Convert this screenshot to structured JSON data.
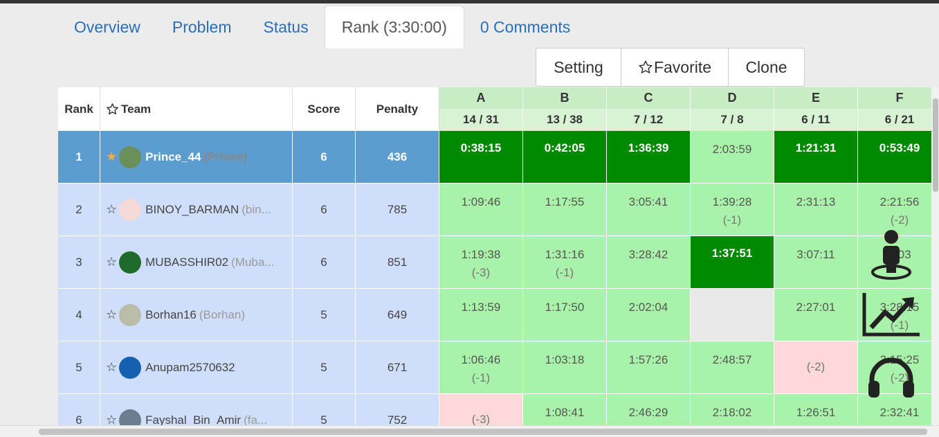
{
  "tabs": [
    {
      "label": "Overview"
    },
    {
      "label": "Problem"
    },
    {
      "label": "Status"
    },
    {
      "label": "Rank (3:30:00)"
    },
    {
      "label": "0 Comments"
    }
  ],
  "actions": {
    "setting": "Setting",
    "favorite": "Favorite",
    "clone": "Clone"
  },
  "table": {
    "headers": {
      "rank": "Rank",
      "team": "Team",
      "score": "Score",
      "penalty": "Penalty"
    },
    "problems": [
      {
        "id": "A",
        "stat": "14 / 31"
      },
      {
        "id": "B",
        "stat": "13 / 38"
      },
      {
        "id": "C",
        "stat": "7 / 12"
      },
      {
        "id": "D",
        "stat": "7 / 8"
      },
      {
        "id": "E",
        "stat": "6 / 11"
      },
      {
        "id": "F",
        "stat": "6 / 21"
      }
    ],
    "rows": [
      {
        "rank": "1",
        "team": "Prince_44",
        "nick": "(Prince)",
        "score": "6",
        "penalty": "436",
        "cells": [
          [
            "0:38:15",
            ""
          ],
          [
            "0:42:05",
            ""
          ],
          [
            "1:36:39",
            ""
          ],
          [
            "2:03:59",
            ""
          ],
          [
            "1:21:31",
            ""
          ],
          [
            "0:53:49",
            ""
          ]
        ]
      },
      {
        "rank": "2",
        "team": "BINOY_BARMAN",
        "nick": "(bin...",
        "score": "6",
        "penalty": "785",
        "cells": [
          [
            "1:09:46",
            ""
          ],
          [
            "1:17:55",
            ""
          ],
          [
            "3:05:41",
            ""
          ],
          [
            "1:39:28",
            "(-1)"
          ],
          [
            "2:31:13",
            ""
          ],
          [
            "2:21:56",
            "(-2)"
          ]
        ]
      },
      {
        "rank": "3",
        "team": "MUBASSHIR02",
        "nick": "(Muba...",
        "score": "6",
        "penalty": "851",
        "cells": [
          [
            "1:19:38",
            "(-3)"
          ],
          [
            "1:31:16",
            "(-1)"
          ],
          [
            "3:28:42",
            ""
          ],
          [
            "1:37:51",
            ""
          ],
          [
            "3:07:11",
            ""
          ],
          [
            "7:03",
            ""
          ]
        ]
      },
      {
        "rank": "4",
        "team": "Borhan16",
        "nick": "(Borhan)",
        "score": "5",
        "penalty": "649",
        "cells": [
          [
            "1:13:59",
            ""
          ],
          [
            "1:17:50",
            ""
          ],
          [
            "2:02:04",
            ""
          ],
          [
            "",
            ""
          ],
          [
            "2:27:01",
            ""
          ],
          [
            "3:28:15",
            "(-1)"
          ]
        ]
      },
      {
        "rank": "5",
        "team": "Anupam2570632",
        "nick": "",
        "score": "5",
        "penalty": "671",
        "cells": [
          [
            "1:06:46",
            "(-1)"
          ],
          [
            "1:03:18",
            ""
          ],
          [
            "1:57:26",
            ""
          ],
          [
            "2:48:57",
            ""
          ],
          [
            "",
            "(-2)"
          ],
          [
            "3:15:25",
            "(-2)"
          ]
        ]
      },
      {
        "rank": "6",
        "team": "Fayshal_Bin_Amir",
        "nick": "(fa...",
        "score": "5",
        "penalty": "752",
        "cells": [
          [
            "",
            "(-3)"
          ],
          [
            "1:08:41",
            ""
          ],
          [
            "2:46:29",
            ""
          ],
          [
            "2:18:02",
            ""
          ],
          [
            "1:26:51",
            ""
          ],
          [
            "2:32:41",
            ""
          ]
        ]
      }
    ]
  },
  "colors": {
    "accepted": "#a9f2a9",
    "first_blood": "#008a00",
    "wrong": "#ffd9d9",
    "leader_row": "#5c9dd0",
    "row": "#cfdffb",
    "tab_link": "#2a6ebb"
  }
}
